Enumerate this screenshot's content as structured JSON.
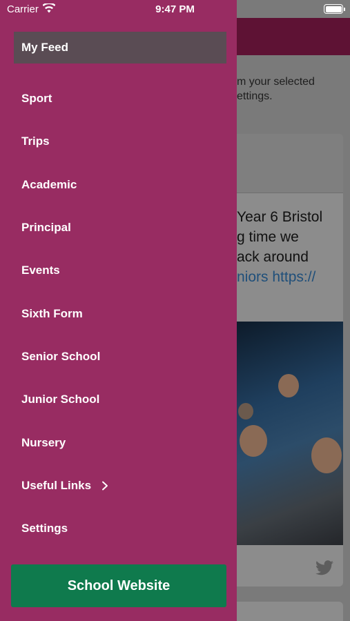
{
  "status_bar": {
    "carrier": "Carrier",
    "time": "9:47 PM"
  },
  "background": {
    "intro_lines": [
      "m your selected",
      "ettings."
    ],
    "post_lines": [
      "Year 6 Bristol",
      "g time we",
      "ack around"
    ],
    "post_link": "niors https://"
  },
  "drawer": {
    "my_feed": "My Feed",
    "items": [
      {
        "label": "Sport"
      },
      {
        "label": "Trips"
      },
      {
        "label": "Academic"
      },
      {
        "label": "Principal"
      },
      {
        "label": "Events"
      },
      {
        "label": "Sixth Form"
      },
      {
        "label": "Senior School"
      },
      {
        "label": "Junior School"
      },
      {
        "label": "Nursery"
      },
      {
        "label": "Useful Links"
      },
      {
        "label": "Settings"
      }
    ],
    "school_website": "School Website"
  },
  "colors": {
    "drawer_bg": "#982c62",
    "feed_button_bg": "#5a4c54",
    "website_button_bg": "#0f7a4d",
    "header_bg": "#5e1234"
  },
  "icons": {
    "wifi": "wifi-icon",
    "battery": "battery-icon",
    "chevron": "chevron-right-icon",
    "twitter": "twitter-icon"
  }
}
